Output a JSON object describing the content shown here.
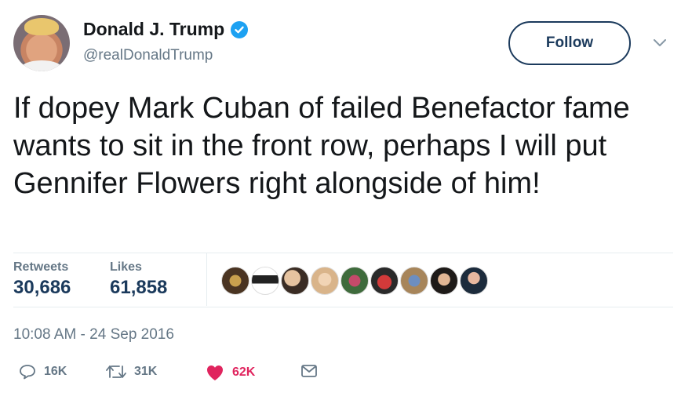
{
  "user": {
    "name": "Donald J. Trump",
    "handle": "@realDonaldTrump",
    "verified_icon": "verified-badge-icon"
  },
  "header": {
    "follow_label": "Follow",
    "menu_icon": "chevron-down-icon"
  },
  "tweet": {
    "text": "If dopey Mark Cuban of failed Benefactor fame wants to sit in the front row, perhaps I will put Gennifer Flowers right alongside of him!",
    "timestamp": "10:08 AM - 24 Sep 2016"
  },
  "stats": {
    "retweets_label": "Retweets",
    "retweets_value": "30,686",
    "likes_label": "Likes",
    "likes_value": "61,858"
  },
  "actions": {
    "reply_count": "16K",
    "retweet_count": "31K",
    "like_count": "62K"
  },
  "colors": {
    "accent": "#1da1f2",
    "follow_border": "#1b3a5c",
    "like": "#e0245e",
    "muted": "#657786"
  }
}
